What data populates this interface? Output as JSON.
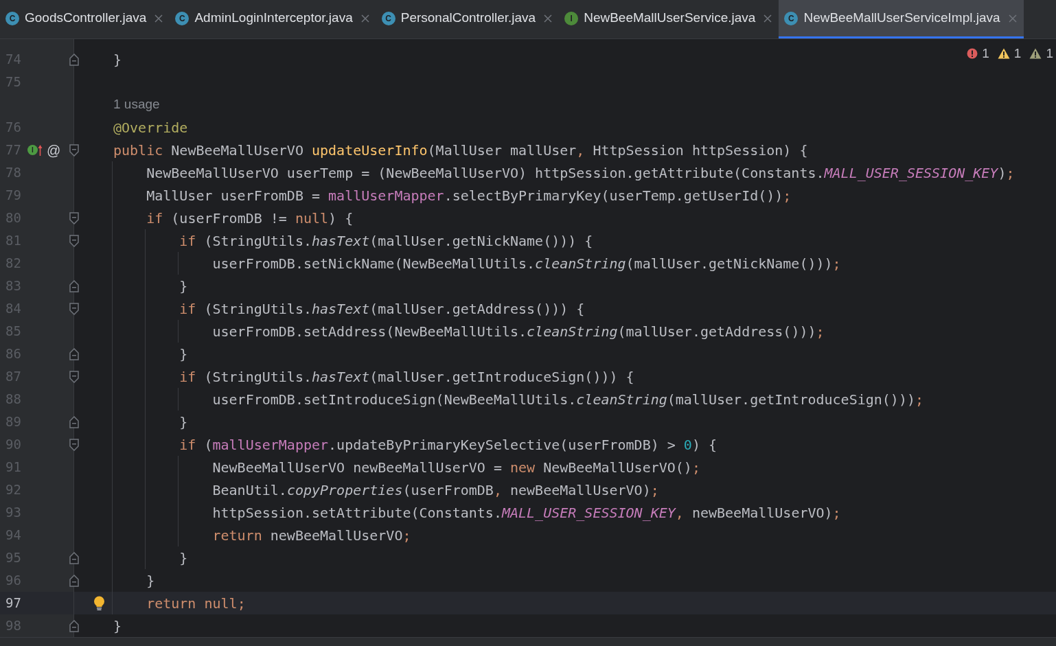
{
  "tabs": [
    {
      "label": "GoodsController.java",
      "icon": {
        "kind": "class",
        "letter": "C"
      },
      "selected": false
    },
    {
      "label": "AdminLoginInterceptor.java",
      "icon": {
        "kind": "class",
        "letter": "C"
      },
      "selected": false
    },
    {
      "label": "PersonalController.java",
      "icon": {
        "kind": "class",
        "letter": "C"
      },
      "selected": false
    },
    {
      "label": "NewBeeMallUserService.java",
      "icon": {
        "kind": "interface",
        "letter": "I"
      },
      "selected": false
    },
    {
      "label": "NewBeeMallUserServiceImpl.java",
      "icon": {
        "kind": "class",
        "letter": "C"
      },
      "selected": true
    }
  ],
  "inspections": [
    {
      "kind": "error",
      "count": "1"
    },
    {
      "kind": "warning",
      "count": "1"
    },
    {
      "kind": "weak_warning",
      "count": "1"
    }
  ],
  "lines": [
    {
      "kind": "code",
      "number": "74",
      "fold": {
        "kind": "end"
      },
      "selected": false,
      "tokens": [
        {
          "kind": "plain",
          "text": "}"
        }
      ]
    },
    {
      "kind": "code",
      "number": "75",
      "selected": false
    },
    {
      "kind": "hint",
      "text": "1 usage"
    },
    {
      "kind": "code",
      "number": "76",
      "selected": false,
      "tokens": [
        {
          "kind": "annotation",
          "text": "@Override"
        }
      ]
    },
    {
      "kind": "code",
      "number": "77",
      "fold": {
        "kind": "start"
      },
      "selected": false,
      "gutter_icons": [
        {
          "kind": "implements",
          "letter": "I"
        },
        {
          "kind": "glyph",
          "text": "@"
        }
      ],
      "tokens": [
        {
          "kind": "keyword",
          "text": "public "
        },
        {
          "kind": "plain",
          "text": "NewBeeMallUserVO "
        },
        {
          "kind": "method",
          "text": "updateUserInfo"
        },
        {
          "kind": "plain",
          "text": "(MallUser mallUser"
        },
        {
          "kind": "punct",
          "text": ", "
        },
        {
          "kind": "plain",
          "text": "HttpSession httpSession) {"
        }
      ]
    },
    {
      "kind": "code",
      "number": "78",
      "selected": false,
      "tokens": [
        {
          "kind": "plain",
          "text": "    NewBeeMallUserVO userTemp = (NewBeeMallUserVO) httpSession.getAttribute(Constants."
        },
        {
          "kind": "constant",
          "text": "MALL_USER_SESSION_KEY"
        },
        {
          "kind": "plain",
          "text": ")"
        },
        {
          "kind": "punct",
          "text": ";"
        }
      ]
    },
    {
      "kind": "code",
      "number": "79",
      "selected": false,
      "tokens": [
        {
          "kind": "plain",
          "text": "    MallUser userFromDB = "
        },
        {
          "kind": "field",
          "text": "mallUserMapper"
        },
        {
          "kind": "plain",
          "text": ".selectByPrimaryKey(userTemp.getUserId())"
        },
        {
          "kind": "punct",
          "text": ";"
        }
      ]
    },
    {
      "kind": "code",
      "number": "80",
      "fold": {
        "kind": "start"
      },
      "selected": false,
      "tokens": [
        {
          "kind": "keyword",
          "text": "    if "
        },
        {
          "kind": "plain",
          "text": "(userFromDB != "
        },
        {
          "kind": "keyword",
          "text": "null"
        },
        {
          "kind": "plain",
          "text": ") {"
        }
      ]
    },
    {
      "kind": "code",
      "number": "81",
      "fold": {
        "kind": "start"
      },
      "selected": false,
      "tokens": [
        {
          "kind": "keyword",
          "text": "        if "
        },
        {
          "kind": "plain",
          "text": "(StringUtils."
        },
        {
          "kind": "static",
          "text": "hasText"
        },
        {
          "kind": "plain",
          "text": "(mallUser.getNickName())) {"
        }
      ]
    },
    {
      "kind": "code",
      "number": "82",
      "selected": false,
      "tokens": [
        {
          "kind": "plain",
          "text": "            userFromDB.setNickName(NewBeeMallUtils."
        },
        {
          "kind": "static",
          "text": "cleanString"
        },
        {
          "kind": "plain",
          "text": "(mallUser.getNickName()))"
        },
        {
          "kind": "punct",
          "text": ";"
        }
      ]
    },
    {
      "kind": "code",
      "number": "83",
      "fold": {
        "kind": "end"
      },
      "selected": false,
      "tokens": [
        {
          "kind": "plain",
          "text": "        }"
        }
      ]
    },
    {
      "kind": "code",
      "number": "84",
      "fold": {
        "kind": "start"
      },
      "selected": false,
      "tokens": [
        {
          "kind": "keyword",
          "text": "        if "
        },
        {
          "kind": "plain",
          "text": "(StringUtils."
        },
        {
          "kind": "static",
          "text": "hasText"
        },
        {
          "kind": "plain",
          "text": "(mallUser.getAddress())) {"
        }
      ]
    },
    {
      "kind": "code",
      "number": "85",
      "selected": false,
      "tokens": [
        {
          "kind": "plain",
          "text": "            userFromDB.setAddress(NewBeeMallUtils."
        },
        {
          "kind": "static",
          "text": "cleanString"
        },
        {
          "kind": "plain",
          "text": "(mallUser.getAddress()))"
        },
        {
          "kind": "punct",
          "text": ";"
        }
      ]
    },
    {
      "kind": "code",
      "number": "86",
      "fold": {
        "kind": "end"
      },
      "selected": false,
      "tokens": [
        {
          "kind": "plain",
          "text": "        }"
        }
      ]
    },
    {
      "kind": "code",
      "number": "87",
      "fold": {
        "kind": "start"
      },
      "selected": false,
      "tokens": [
        {
          "kind": "keyword",
          "text": "        if "
        },
        {
          "kind": "plain",
          "text": "(StringUtils."
        },
        {
          "kind": "static",
          "text": "hasText"
        },
        {
          "kind": "plain",
          "text": "(mallUser.getIntroduceSign())) {"
        }
      ]
    },
    {
      "kind": "code",
      "number": "88",
      "selected": false,
      "tokens": [
        {
          "kind": "plain",
          "text": "            userFromDB.setIntroduceSign(NewBeeMallUtils."
        },
        {
          "kind": "static",
          "text": "cleanString"
        },
        {
          "kind": "plain",
          "text": "(mallUser.getIntroduceSign()))"
        },
        {
          "kind": "punct",
          "text": ";"
        }
      ]
    },
    {
      "kind": "code",
      "number": "89",
      "fold": {
        "kind": "end"
      },
      "selected": false,
      "tokens": [
        {
          "kind": "plain",
          "text": "        }"
        }
      ]
    },
    {
      "kind": "code",
      "number": "90",
      "fold": {
        "kind": "start"
      },
      "selected": false,
      "tokens": [
        {
          "kind": "keyword",
          "text": "        if "
        },
        {
          "kind": "plain",
          "text": "("
        },
        {
          "kind": "field",
          "text": "mallUserMapper"
        },
        {
          "kind": "plain",
          "text": ".updateByPrimaryKeySelective(userFromDB) > "
        },
        {
          "kind": "number",
          "text": "0"
        },
        {
          "kind": "plain",
          "text": ") {"
        }
      ]
    },
    {
      "kind": "code",
      "number": "91",
      "selected": false,
      "tokens": [
        {
          "kind": "plain",
          "text": "            NewBeeMallUserVO newBeeMallUserVO = "
        },
        {
          "kind": "keyword",
          "text": "new "
        },
        {
          "kind": "plain",
          "text": "NewBeeMallUserVO()"
        },
        {
          "kind": "punct",
          "text": ";"
        }
      ]
    },
    {
      "kind": "code",
      "number": "92",
      "selected": false,
      "tokens": [
        {
          "kind": "plain",
          "text": "            BeanUtil."
        },
        {
          "kind": "static",
          "text": "copyProperties"
        },
        {
          "kind": "plain",
          "text": "(userFromDB"
        },
        {
          "kind": "punct",
          "text": ", "
        },
        {
          "kind": "plain",
          "text": "newBeeMallUserVO)"
        },
        {
          "kind": "punct",
          "text": ";"
        }
      ]
    },
    {
      "kind": "code",
      "number": "93",
      "selected": false,
      "tokens": [
        {
          "kind": "plain",
          "text": "            httpSession.setAttribute(Constants."
        },
        {
          "kind": "constant",
          "text": "MALL_USER_SESSION_KEY"
        },
        {
          "kind": "punct",
          "text": ", "
        },
        {
          "kind": "plain",
          "text": "newBeeMallUserVO)"
        },
        {
          "kind": "punct",
          "text": ";"
        }
      ]
    },
    {
      "kind": "code",
      "number": "94",
      "selected": false,
      "tokens": [
        {
          "kind": "keyword",
          "text": "            return "
        },
        {
          "kind": "plain",
          "text": "newBeeMallUserVO"
        },
        {
          "kind": "punct",
          "text": ";"
        }
      ]
    },
    {
      "kind": "code",
      "number": "95",
      "fold": {
        "kind": "end"
      },
      "selected": false,
      "tokens": [
        {
          "kind": "plain",
          "text": "        }"
        }
      ]
    },
    {
      "kind": "code",
      "number": "96",
      "fold": {
        "kind": "end"
      },
      "selected": false,
      "tokens": [
        {
          "kind": "plain",
          "text": "    }"
        }
      ]
    },
    {
      "kind": "code",
      "number": "97",
      "selected": true,
      "bulb": true,
      "tokens": [
        {
          "kind": "keyword",
          "text": "    return null"
        },
        {
          "kind": "punct",
          "text": ";"
        }
      ]
    },
    {
      "kind": "code",
      "number": "98",
      "fold": {
        "kind": "end"
      },
      "selected": false,
      "tokens": [
        {
          "kind": "plain",
          "text": "}"
        }
      ]
    }
  ]
}
